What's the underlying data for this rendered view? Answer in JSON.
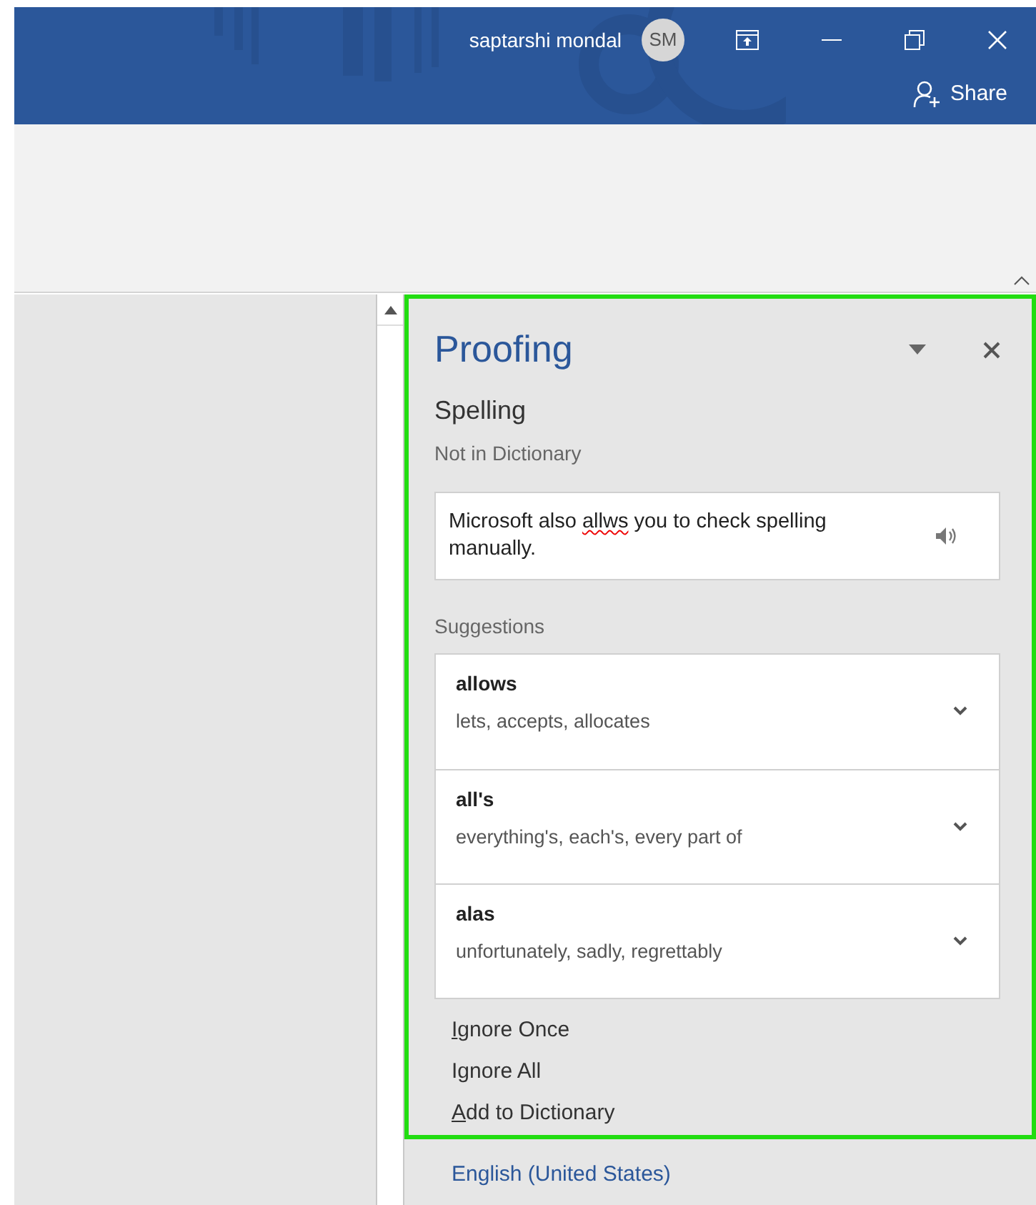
{
  "title_bar": {
    "user_name": "saptarshi mondal",
    "avatar_initials": "SM",
    "share_label": "Share"
  },
  "pane": {
    "title": "Proofing",
    "section": "Spelling",
    "status": "Not in Dictionary",
    "sentence": {
      "before": "Microsoft also ",
      "misspelled": "allws",
      "after": " you to check spelling manually."
    },
    "suggestions_label": "Suggestions",
    "suggestions": [
      {
        "word": "allows",
        "synonyms": "lets, accepts, allocates"
      },
      {
        "word": "all's",
        "synonyms": "everything's, each's, every part of"
      },
      {
        "word": "alas",
        "synonyms": "unfortunately, sadly, regrettably"
      }
    ],
    "actions": [
      {
        "key": "I",
        "after": "gnore Once"
      },
      {
        "before": "I",
        "key": "g",
        "after": "nore All"
      },
      {
        "key": "A",
        "after": "dd to Dictionary"
      }
    ],
    "language": "English (United States)"
  }
}
